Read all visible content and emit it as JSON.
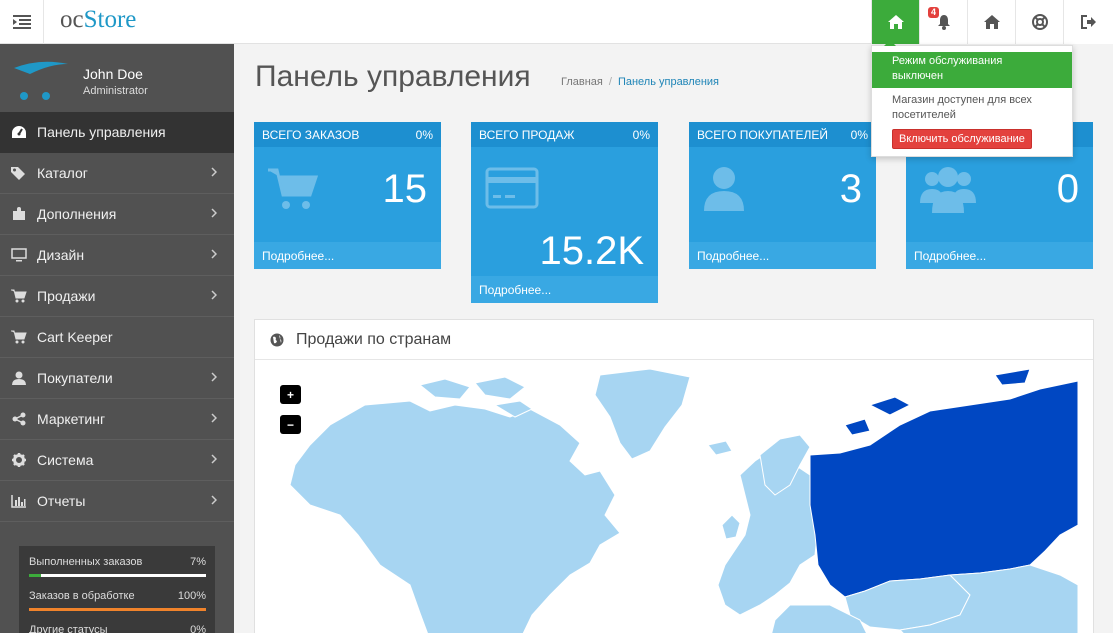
{
  "header": {
    "logo_prefix": "oc",
    "logo_brand": "Store",
    "notification_count": "4",
    "buttons": [
      "home-icon",
      "bell-icon",
      "home-icon",
      "life-ring-icon",
      "sign-out-icon"
    ]
  },
  "sidebar": {
    "user_name": "John Doe",
    "user_role": "Administrator",
    "items": [
      {
        "label": "Панель управления",
        "icon": "dashboard-icon",
        "active": true,
        "has_arrow": false
      },
      {
        "label": "Каталог",
        "icon": "tags-icon",
        "has_arrow": true
      },
      {
        "label": "Дополнения",
        "icon": "puzzle-icon",
        "has_arrow": true
      },
      {
        "label": "Дизайн",
        "icon": "desktop-icon",
        "has_arrow": true
      },
      {
        "label": "Продажи",
        "icon": "cart-icon",
        "has_arrow": true
      },
      {
        "label": "Cart Keeper",
        "icon": "cart-plus-icon",
        "has_arrow": false
      },
      {
        "label": "Покупатели",
        "icon": "user-icon",
        "has_arrow": true
      },
      {
        "label": "Маркетинг",
        "icon": "share-icon",
        "has_arrow": true
      },
      {
        "label": "Система",
        "icon": "cog-icon",
        "has_arrow": true
      },
      {
        "label": "Отчеты",
        "icon": "bar-chart-icon",
        "has_arrow": true
      }
    ],
    "stats": [
      {
        "label": "Выполненных заказов",
        "value": "7%",
        "fraction": 0.07,
        "color": "#3cab3b"
      },
      {
        "label": "Заказов в обработке",
        "value": "100%",
        "fraction": 1.0,
        "color": "#f0832b"
      },
      {
        "label": "Другие статусы",
        "value": "0%",
        "fraction": 0.0,
        "color": "#e3413d"
      }
    ]
  },
  "main": {
    "title": "Панель управления",
    "breadcrumb": [
      "Главная",
      "Панель управления"
    ],
    "tiles": [
      {
        "heading": "ВСЕГО ЗАКАЗОВ",
        "percent": "0%",
        "value": "15",
        "footer": "Подробнее...",
        "icon": "cart-icon"
      },
      {
        "heading": "ВСЕГО ПРОДАЖ",
        "percent": "0%",
        "value": "15.2K",
        "footer": "Подробнее...",
        "icon": "credit-card-icon"
      },
      {
        "heading": "ВСЕГО ПОКУПАТЕЛЕЙ",
        "percent": "0%",
        "value": "3",
        "footer": "Подробнее...",
        "icon": "user-icon"
      },
      {
        "heading": "",
        "percent": "",
        "value": "0",
        "footer": "Подробнее...",
        "icon": "users-icon"
      }
    ],
    "map": {
      "title": "Продажи по странам",
      "zoom_in": "+",
      "zoom_out": "−"
    }
  },
  "maintenance": {
    "status": "Режим обслуживания выключен",
    "text": "Магазин доступен для всех посетителей",
    "button": "Включить обслуживание"
  },
  "colors": {
    "accent_green": "#3cab3b",
    "tile_blue": "#2a9fde",
    "map_highlight": "#0047c2",
    "map_land": "#a7d5f2",
    "danger": "#e3413d"
  }
}
